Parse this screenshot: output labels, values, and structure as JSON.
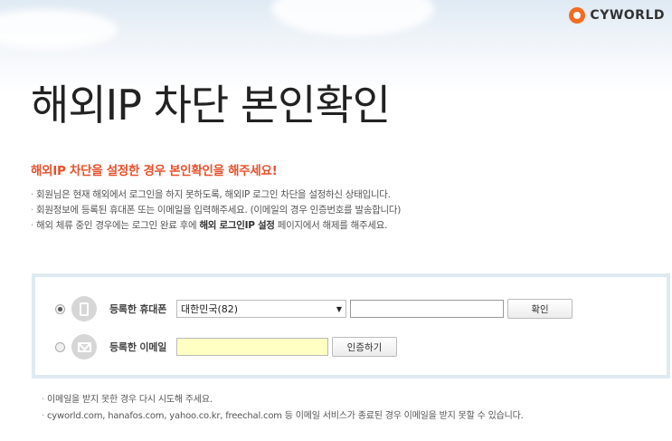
{
  "brand": {
    "logo_text": "CYWORLD",
    "accent": "#f36b21"
  },
  "page": {
    "title": "해외IP 차단 본인확인"
  },
  "intro": {
    "headline": "해외IP 차단을 설정한 경우 본인확인을 해주세요!",
    "notes": [
      "회원님은 현재 해외에서 로그인을 하지 못하도록, 해외IP 로그인 차단을 설정하신 상태입니다.",
      "회원정보에 등록된 휴대폰 또는 이메일을 입력해주세요. (이메일의 경우 인증번호를 발송합니다)"
    ],
    "note3": {
      "before": "해외 체류 중인 경우에는 로그인 완료 후에 ",
      "bold": "해외 로그인IP 설정",
      "after": " 페이지에서 해제를 해주세요."
    }
  },
  "auth": {
    "phone": {
      "label": "등록한 휴대폰",
      "country_selected": "대한민국(82)",
      "phone_value": "",
      "confirm_label": "확인",
      "checked": true,
      "icon": "mobile-phone-icon"
    },
    "email": {
      "label": "등록한 이메일",
      "email_value": "",
      "send_code_label": "인증하기",
      "checked": false,
      "icon": "envelope-icon"
    }
  },
  "footer_notes": [
    "이메일을 받지 못한 경우 다시 시도해 주세요.",
    "cyworld.com, hanafos.com, yahoo.co.kr, freechal.com 등 이메일 서비스가 종료된 경우 이메일을 받지 못할 수 있습니다."
  ]
}
